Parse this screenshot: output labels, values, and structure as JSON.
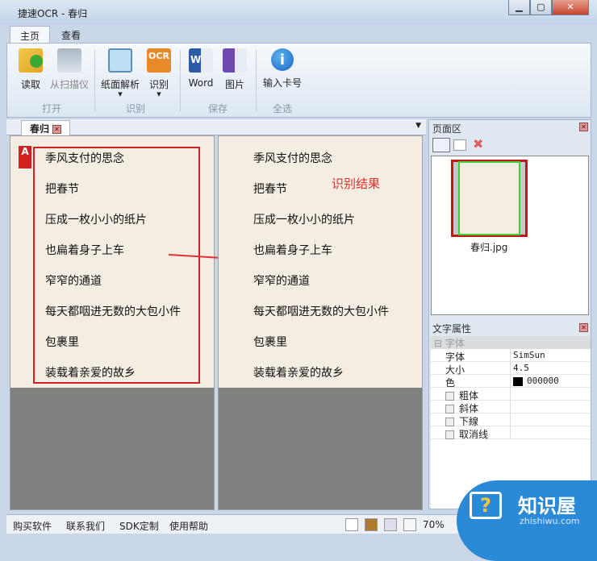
{
  "window": {
    "title": "捷速OCR - 春归",
    "min": "▁",
    "max": "▢",
    "close": "✕"
  },
  "ribbon": {
    "tabs": [
      {
        "label": "主页"
      },
      {
        "label": "查看"
      }
    ],
    "buttons": [
      {
        "label": "读取",
        "icon": "folder-open-icon"
      },
      {
        "label": "从扫描仪",
        "icon": "scanner-icon"
      },
      {
        "label": "纸面解析",
        "icon": "layout-analysis-icon"
      },
      {
        "label": "识别",
        "icon": "ocr-icon"
      },
      {
        "label": "Word",
        "icon": "word-icon"
      },
      {
        "label": "图片",
        "icon": "image-icon"
      },
      {
        "label": "输入卡号",
        "icon": "info-icon"
      }
    ],
    "groups": [
      "打开",
      "识别",
      "保存",
      "全选"
    ]
  },
  "document": {
    "tab": "春归",
    "lines": [
      "季风支付的思念",
      "把春节",
      "压成一枚小小的纸片",
      "也扁着身子上车",
      "窄窄的通道",
      "每天都咽进无数的大包小件",
      "包裹里",
      "装载着亲爱的故乡"
    ],
    "result_label": "识别结果"
  },
  "page_panel": {
    "title": "页面区",
    "thumbnail_name": "春归.jpg"
  },
  "text_props": {
    "title": "文字属性",
    "category": "字体",
    "rows": [
      {
        "k": "字体",
        "v": "SimSun"
      },
      {
        "k": "大小",
        "v": "4.5"
      },
      {
        "k": "色",
        "v": "000000"
      }
    ],
    "checks": [
      "粗体",
      "斜体",
      "下線",
      "取消线"
    ]
  },
  "status": {
    "links": [
      "购买软件",
      "联系我们",
      "SDK定制",
      "使用帮助"
    ],
    "zoom": "70%"
  },
  "watermark": {
    "text": "知识屋",
    "sub": "zhishiwu.com"
  },
  "colors": {
    "accent_red": "#e03030",
    "select_red": "#d42020",
    "thumb_green": "#3bd13b"
  }
}
